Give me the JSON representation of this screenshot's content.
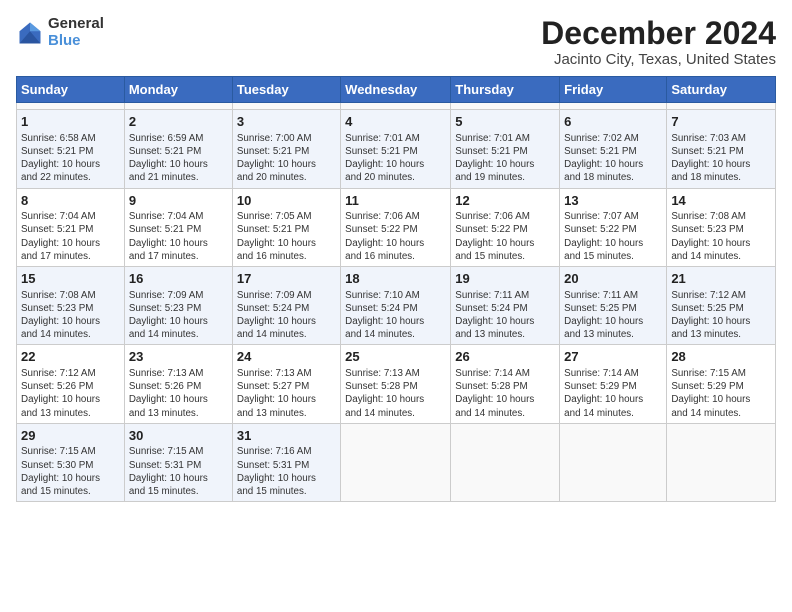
{
  "header": {
    "logo_general": "General",
    "logo_blue": "Blue",
    "title": "December 2024",
    "subtitle": "Jacinto City, Texas, United States"
  },
  "calendar": {
    "days_of_week": [
      "Sunday",
      "Monday",
      "Tuesday",
      "Wednesday",
      "Thursday",
      "Friday",
      "Saturday"
    ],
    "weeks": [
      [
        {
          "day": "",
          "info": ""
        },
        {
          "day": "",
          "info": ""
        },
        {
          "day": "",
          "info": ""
        },
        {
          "day": "",
          "info": ""
        },
        {
          "day": "",
          "info": ""
        },
        {
          "day": "",
          "info": ""
        },
        {
          "day": "",
          "info": ""
        }
      ],
      [
        {
          "day": "1",
          "info": "Sunrise: 6:58 AM\nSunset: 5:21 PM\nDaylight: 10 hours\nand 22 minutes."
        },
        {
          "day": "2",
          "info": "Sunrise: 6:59 AM\nSunset: 5:21 PM\nDaylight: 10 hours\nand 21 minutes."
        },
        {
          "day": "3",
          "info": "Sunrise: 7:00 AM\nSunset: 5:21 PM\nDaylight: 10 hours\nand 20 minutes."
        },
        {
          "day": "4",
          "info": "Sunrise: 7:01 AM\nSunset: 5:21 PM\nDaylight: 10 hours\nand 20 minutes."
        },
        {
          "day": "5",
          "info": "Sunrise: 7:01 AM\nSunset: 5:21 PM\nDaylight: 10 hours\nand 19 minutes."
        },
        {
          "day": "6",
          "info": "Sunrise: 7:02 AM\nSunset: 5:21 PM\nDaylight: 10 hours\nand 18 minutes."
        },
        {
          "day": "7",
          "info": "Sunrise: 7:03 AM\nSunset: 5:21 PM\nDaylight: 10 hours\nand 18 minutes."
        }
      ],
      [
        {
          "day": "8",
          "info": "Sunrise: 7:04 AM\nSunset: 5:21 PM\nDaylight: 10 hours\nand 17 minutes."
        },
        {
          "day": "9",
          "info": "Sunrise: 7:04 AM\nSunset: 5:21 PM\nDaylight: 10 hours\nand 17 minutes."
        },
        {
          "day": "10",
          "info": "Sunrise: 7:05 AM\nSunset: 5:21 PM\nDaylight: 10 hours\nand 16 minutes."
        },
        {
          "day": "11",
          "info": "Sunrise: 7:06 AM\nSunset: 5:22 PM\nDaylight: 10 hours\nand 16 minutes."
        },
        {
          "day": "12",
          "info": "Sunrise: 7:06 AM\nSunset: 5:22 PM\nDaylight: 10 hours\nand 15 minutes."
        },
        {
          "day": "13",
          "info": "Sunrise: 7:07 AM\nSunset: 5:22 PM\nDaylight: 10 hours\nand 15 minutes."
        },
        {
          "day": "14",
          "info": "Sunrise: 7:08 AM\nSunset: 5:23 PM\nDaylight: 10 hours\nand 14 minutes."
        }
      ],
      [
        {
          "day": "15",
          "info": "Sunrise: 7:08 AM\nSunset: 5:23 PM\nDaylight: 10 hours\nand 14 minutes."
        },
        {
          "day": "16",
          "info": "Sunrise: 7:09 AM\nSunset: 5:23 PM\nDaylight: 10 hours\nand 14 minutes."
        },
        {
          "day": "17",
          "info": "Sunrise: 7:09 AM\nSunset: 5:24 PM\nDaylight: 10 hours\nand 14 minutes."
        },
        {
          "day": "18",
          "info": "Sunrise: 7:10 AM\nSunset: 5:24 PM\nDaylight: 10 hours\nand 14 minutes."
        },
        {
          "day": "19",
          "info": "Sunrise: 7:11 AM\nSunset: 5:24 PM\nDaylight: 10 hours\nand 13 minutes."
        },
        {
          "day": "20",
          "info": "Sunrise: 7:11 AM\nSunset: 5:25 PM\nDaylight: 10 hours\nand 13 minutes."
        },
        {
          "day": "21",
          "info": "Sunrise: 7:12 AM\nSunset: 5:25 PM\nDaylight: 10 hours\nand 13 minutes."
        }
      ],
      [
        {
          "day": "22",
          "info": "Sunrise: 7:12 AM\nSunset: 5:26 PM\nDaylight: 10 hours\nand 13 minutes."
        },
        {
          "day": "23",
          "info": "Sunrise: 7:13 AM\nSunset: 5:26 PM\nDaylight: 10 hours\nand 13 minutes."
        },
        {
          "day": "24",
          "info": "Sunrise: 7:13 AM\nSunset: 5:27 PM\nDaylight: 10 hours\nand 13 minutes."
        },
        {
          "day": "25",
          "info": "Sunrise: 7:13 AM\nSunset: 5:28 PM\nDaylight: 10 hours\nand 14 minutes."
        },
        {
          "day": "26",
          "info": "Sunrise: 7:14 AM\nSunset: 5:28 PM\nDaylight: 10 hours\nand 14 minutes."
        },
        {
          "day": "27",
          "info": "Sunrise: 7:14 AM\nSunset: 5:29 PM\nDaylight: 10 hours\nand 14 minutes."
        },
        {
          "day": "28",
          "info": "Sunrise: 7:15 AM\nSunset: 5:29 PM\nDaylight: 10 hours\nand 14 minutes."
        }
      ],
      [
        {
          "day": "29",
          "info": "Sunrise: 7:15 AM\nSunset: 5:30 PM\nDaylight: 10 hours\nand 15 minutes."
        },
        {
          "day": "30",
          "info": "Sunrise: 7:15 AM\nSunset: 5:31 PM\nDaylight: 10 hours\nand 15 minutes."
        },
        {
          "day": "31",
          "info": "Sunrise: 7:16 AM\nSunset: 5:31 PM\nDaylight: 10 hours\nand 15 minutes."
        },
        {
          "day": "",
          "info": ""
        },
        {
          "day": "",
          "info": ""
        },
        {
          "day": "",
          "info": ""
        },
        {
          "day": "",
          "info": ""
        }
      ]
    ]
  }
}
